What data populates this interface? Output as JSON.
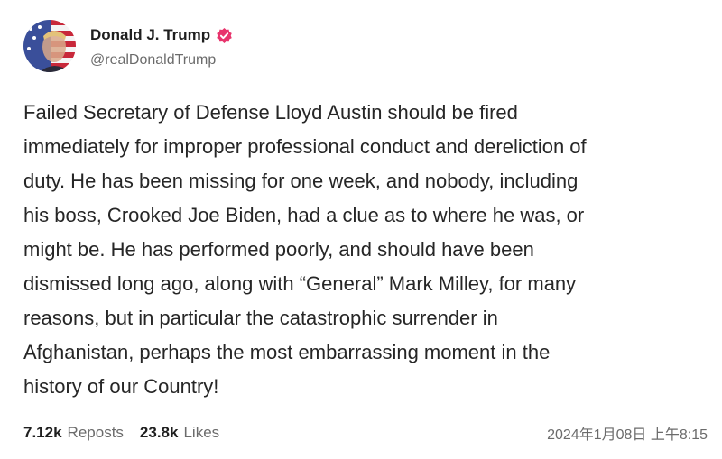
{
  "post": {
    "author": {
      "display_name": "Donald J. Trump",
      "handle": "@realDonaldTrump",
      "verified": true,
      "verified_color": "#e8356d"
    },
    "body_lines": [
      "Failed Secretary of Defense Lloyd Austin should be fired",
      "immediately for improper professional conduct and dereliction of",
      "duty. He has been missing for one week, and nobody, including",
      "his boss, Crooked Joe Biden, had a clue as to where he was, or",
      "might be. He has performed poorly, and should have been",
      "dismissed long ago, along with “General” Mark Milley, for many",
      "reasons, but in particular the catastrophic surrender in",
      "Afghanistan, perhaps the most embarrassing moment in the",
      "history of our Country!"
    ],
    "stats": {
      "reposts_count": "7.12k",
      "reposts_label": "Reposts",
      "likes_count": "23.8k",
      "likes_label": "Likes"
    },
    "timestamp": "2024年1月08日 上午8:15"
  },
  "icons": {
    "avatar": "flag-portrait-avatar",
    "verified": "verified-badge-icon"
  }
}
